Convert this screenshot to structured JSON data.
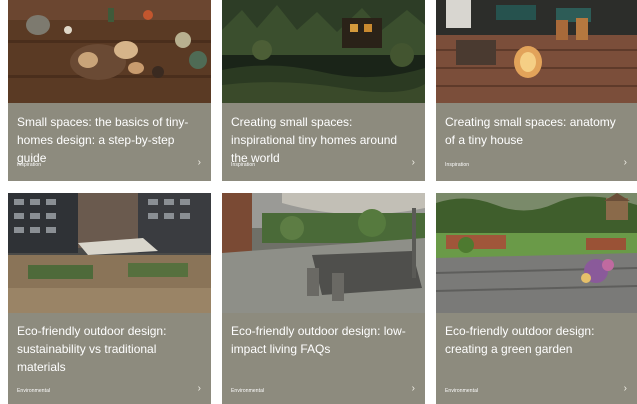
{
  "cards": [
    {
      "title": "Small spaces: the basics of tiny-homes design: a step-by-step guide",
      "tag": "Inspiration",
      "image": "overhead-wooden-table-with-food"
    },
    {
      "title": "Creating small spaces: inspirational tiny homes around the world",
      "tag": "Inspiration",
      "image": "forest-cabin-at-dusk"
    },
    {
      "title": "Creating small spaces: anatomy of a tiny house",
      "tag": "Inspiration",
      "image": "wooden-deck-with-lanterns"
    },
    {
      "title": "Eco-friendly outdoor design: sustainability vs traditional materials",
      "tag": "Environmental",
      "image": "rooftop-terrace-with-planters"
    },
    {
      "title": "Eco-friendly outdoor design: low-impact living FAQs",
      "tag": "Environmental",
      "image": "garden-deck-with-dining-table"
    },
    {
      "title": "Eco-friendly outdoor design: creating a green garden",
      "tag": "Environmental",
      "image": "garden-with-paved-terrace"
    }
  ],
  "chevron_icon": "chevron-right-icon",
  "colors": {
    "card_background": "#8d8b7e",
    "text": "#ffffff"
  }
}
